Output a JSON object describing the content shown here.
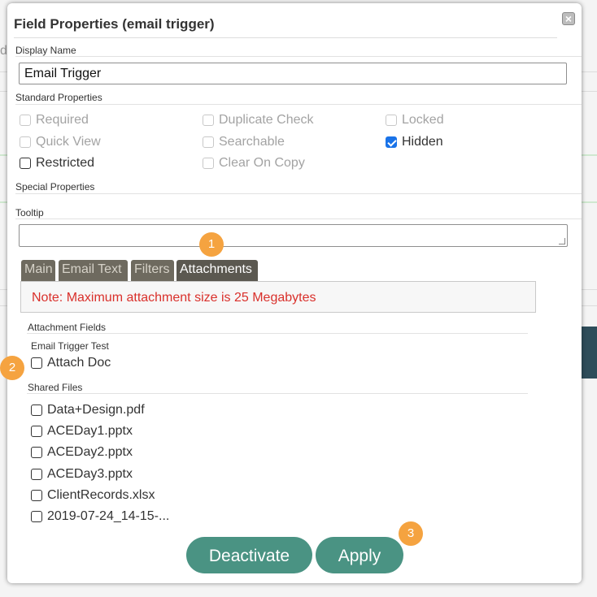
{
  "background": {
    "partial_letter": "d"
  },
  "dialog": {
    "title": "Field Properties (email trigger)",
    "close_icon": "close-icon"
  },
  "display_name": {
    "label": "Display Name",
    "value": "Email Trigger"
  },
  "standard_properties": {
    "label": "Standard Properties",
    "items": [
      {
        "label": "Required",
        "checked": false,
        "disabled": true
      },
      {
        "label": "Duplicate Check",
        "checked": false,
        "disabled": true
      },
      {
        "label": "Locked",
        "checked": false,
        "disabled": true
      },
      {
        "label": "Quick View",
        "checked": false,
        "disabled": true
      },
      {
        "label": "Searchable",
        "checked": false,
        "disabled": true
      },
      {
        "label": "Hidden",
        "checked": true,
        "disabled": false
      },
      {
        "label": "Restricted",
        "checked": false,
        "disabled": false
      },
      {
        "label": "Clear On Copy",
        "checked": false,
        "disabled": true
      }
    ]
  },
  "special_properties": {
    "label": "Special Properties"
  },
  "tooltip": {
    "label": "Tooltip",
    "value": ""
  },
  "tabs": [
    {
      "label": "Main",
      "active": false
    },
    {
      "label": "Email Text",
      "active": false
    },
    {
      "label": "Filters",
      "active": false
    },
    {
      "label": "Attachments",
      "active": true
    }
  ],
  "note": "Note: Maximum attachment size is 25 Megabytes",
  "attachment_fields": {
    "label": "Attachment Fields",
    "group_label": "Email Trigger Test",
    "items": [
      {
        "label": "Attach Doc",
        "checked": false
      }
    ]
  },
  "shared_files": {
    "label": "Shared Files",
    "items": [
      {
        "label": "Data+Design.pdf",
        "checked": false
      },
      {
        "label": "ACEDay1.pptx",
        "checked": false
      },
      {
        "label": "ACEDay2.pptx",
        "checked": false
      },
      {
        "label": "ACEDay3.pptx",
        "checked": false
      },
      {
        "label": "ClientRecords.xlsx",
        "checked": false
      },
      {
        "label": "2019-07-24_14-15-...",
        "checked": false
      }
    ]
  },
  "buttons": {
    "deactivate": "Deactivate",
    "apply": "Apply"
  },
  "callouts": [
    "1",
    "2",
    "3"
  ],
  "colors": {
    "accent": "#4a9383",
    "tab": "#6e6a5f",
    "callout": "#f5a340",
    "note": "#d9302b",
    "checkbox_checked": "#1a73e8"
  }
}
